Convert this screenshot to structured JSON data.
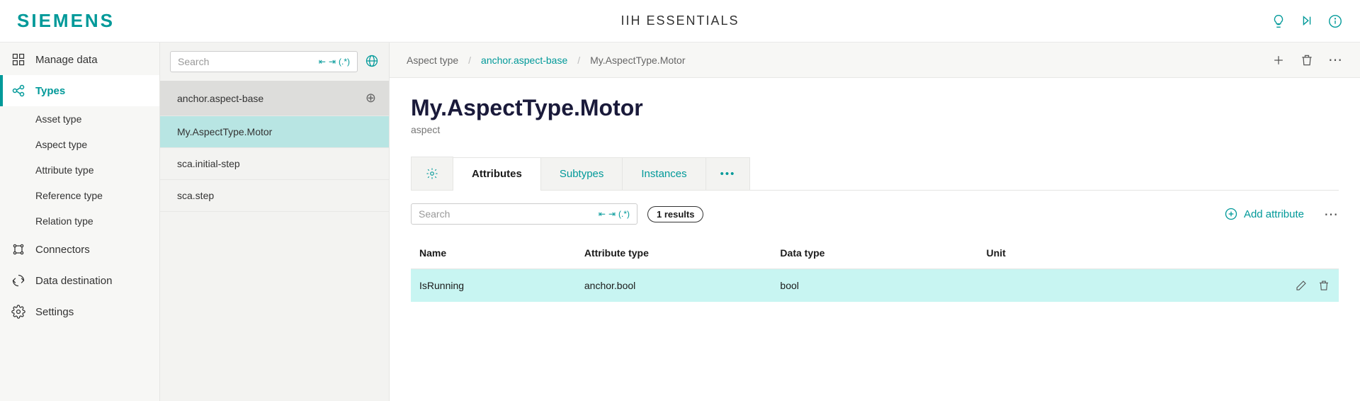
{
  "header": {
    "brand": "SIEMENS",
    "app_title": "IIH ESSENTIALS"
  },
  "sidebar": {
    "items": [
      {
        "id": "manage-data",
        "label": "Manage data"
      },
      {
        "id": "types",
        "label": "Types",
        "active": true,
        "children": [
          {
            "id": "asset-type",
            "label": "Asset type"
          },
          {
            "id": "aspect-type",
            "label": "Aspect type"
          },
          {
            "id": "attribute-type",
            "label": "Attribute type"
          },
          {
            "id": "reference-type",
            "label": "Reference type"
          },
          {
            "id": "relation-type",
            "label": "Relation type"
          }
        ]
      },
      {
        "id": "connectors",
        "label": "Connectors"
      },
      {
        "id": "data-destination",
        "label": "Data destination"
      },
      {
        "id": "settings",
        "label": "Settings"
      }
    ]
  },
  "types_list": {
    "search_placeholder": "Search",
    "items": [
      {
        "label": "anchor.aspect-base",
        "is_header": true
      },
      {
        "label": "My.AspectType.Motor",
        "selected": true
      },
      {
        "label": "sca.initial-step"
      },
      {
        "label": "sca.step"
      }
    ]
  },
  "breadcrumb": {
    "items": [
      {
        "label": "Aspect type",
        "link": false
      },
      {
        "label": "anchor.aspect-base",
        "link": true
      },
      {
        "label": "My.AspectType.Motor",
        "link": false
      }
    ]
  },
  "detail": {
    "title": "My.AspectType.Motor",
    "subtitle": "aspect",
    "tabs": [
      {
        "id": "settings",
        "icon_only": true
      },
      {
        "id": "attributes",
        "label": "Attributes",
        "active": true
      },
      {
        "id": "subtypes",
        "label": "Subtypes"
      },
      {
        "id": "instances",
        "label": "Instances"
      },
      {
        "id": "more",
        "icon_only": true,
        "dots": true
      }
    ],
    "attr_search_placeholder": "Search",
    "result_count": "1 results",
    "add_attribute_label": "Add attribute",
    "columns": {
      "name": "Name",
      "attribute_type": "Attribute type",
      "data_type": "Data type",
      "unit": "Unit"
    },
    "rows": [
      {
        "name": "IsRunning",
        "attribute_type": "anchor.bool",
        "data_type": "bool",
        "unit": ""
      }
    ]
  }
}
